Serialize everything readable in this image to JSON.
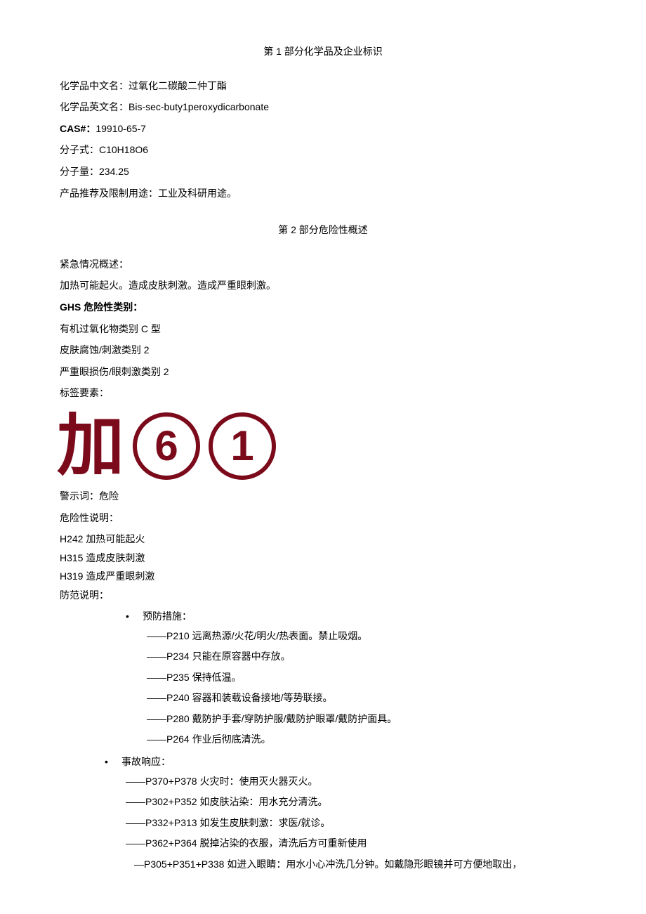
{
  "section1": {
    "title": "第 1 部分化学品及企业标识",
    "name_cn_label": "化学品中文名：",
    "name_cn": "过氧化二碳酸二仲丁酯",
    "name_en_label": "化学品英文名：",
    "name_en": "Bis-sec-buty1peroxydicarbonate",
    "cas_label": "CAS#：",
    "cas": "19910-65-7",
    "formula_label": "分子式：",
    "formula": "C10H18O6",
    "mw_label": "分子量：",
    "mw": "234.25",
    "use_label": "产品推荐及限制用途：",
    "use": "工业及科研用途。"
  },
  "section2": {
    "title": "第 2 部分危险性概述",
    "emergency_label": "紧急情况概述：",
    "emergency_text": "加热可能起火。造成皮肤刺激。造成严重眼刺激。",
    "ghs_label": "GHS 危险性类别：",
    "ghs_lines": [
      "有机过氧化物类别 C 型",
      "皮肤腐蚀/刺激类别 2",
      "严重眼损伤/眼刺激类别 2"
    ],
    "label_elements_label": "标签要素：",
    "pictograms": {
      "jia": "加",
      "n6": "6",
      "n1": "1"
    },
    "signal_label": "警示词：",
    "signal": "危险",
    "hazard_label": "危险性说明：",
    "hazard_lines": [
      "H242 加热可能起火",
      "H315 造成皮肤刺激",
      "H319 造成严重眼刺激"
    ],
    "precaution_label": "防范说明：",
    "prevention_header": "预防措施：",
    "prevention_items": [
      "——P210 远离热源/火花/明火/热表面。禁止吸烟。",
      "——P234 只能在原容器中存放。",
      "——P235 保持低温。",
      "——P240 容器和装载设备接地/等势联接。",
      "——P280 戴防护手套/穿防护服/戴防护眼罩/戴防护面具。",
      "——P264 作业后彻底清洗。"
    ],
    "response_header": "事故响应：",
    "response_items": [
      "——P370+P378 火灾时：使用灭火器灭火。",
      "——P302+P352 如皮肤沾染：用水充分清洗。",
      "——P332+P313 如发生皮肤刺激：求医/就诊。",
      "——P362+P364 脱掉沾染的衣服，清洗后方可重新使用",
      "—P305+P351+P338 如进入眼睛：用水小心冲洗几分钟。如戴隐形眼镜并可方便地取出，"
    ]
  }
}
